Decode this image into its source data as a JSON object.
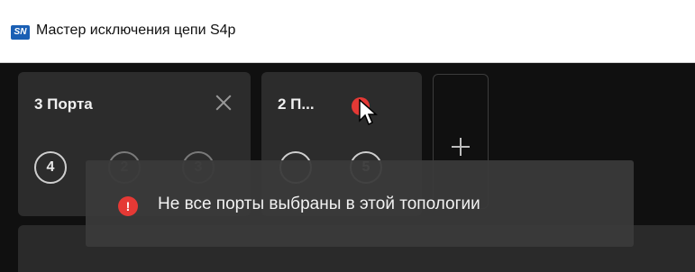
{
  "window": {
    "icon_text": "SN",
    "title": "Мастер исключения цепи S4p"
  },
  "tabs": [
    {
      "title": "3 Порта",
      "ports": [
        "4",
        "2",
        "3"
      ]
    },
    {
      "title": "2 П...",
      "ports": [
        "",
        "5"
      ]
    }
  ],
  "add_tab_label": "+",
  "tooltip": {
    "icon": "!",
    "text": "Не все порты выбраны в этой топологии"
  },
  "colors": {
    "error": "#e53935",
    "app_icon": "#1a5fb4",
    "tab_bg": "#2c2c2c"
  }
}
